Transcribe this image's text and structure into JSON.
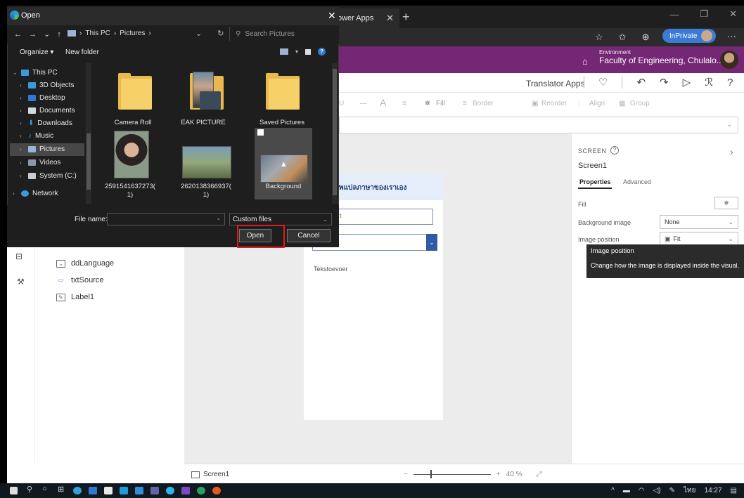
{
  "browser": {
    "tab_label": "ower Apps",
    "inprivate_label": "InPrivate"
  },
  "powerapps": {
    "environment_label": "Environment",
    "environment_name": "Faculty of Engineering, Chulalo...",
    "app_title": "Translator Apps",
    "ribbon": {
      "fill": "Fill",
      "border": "Border",
      "reorder": "Reorder",
      "align": "Align",
      "group": "Group"
    },
    "tree": {
      "items": [
        "ddLanguage",
        "txtSource",
        "Label1"
      ]
    },
    "canvas": {
      "header_text": "ัพแปลภาษาของเราเอง",
      "input_text": "t",
      "output_label": "Tekstoevoer"
    },
    "status": {
      "screen_tab": "Screen1",
      "zoom_minus": "−",
      "zoom_plus": "+",
      "zoom_value": "40 %",
      "zoom_fraction": 0.4
    },
    "properties": {
      "type_label": "SCREEN",
      "name": "Screen1",
      "tabs": [
        "Properties",
        "Advanced"
      ],
      "fill_label": "Fill",
      "bg_image_label": "Background image",
      "bg_image_value": "None",
      "image_pos_label": "Image position",
      "image_pos_value": "Fit"
    },
    "tooltip": {
      "title": "Image position",
      "body": "Change how the image is displayed inside the visual."
    }
  },
  "dialog": {
    "title": "Open",
    "breadcrumb": [
      "This PC",
      "Pictures"
    ],
    "search_placeholder": "Search Pictures",
    "toolbar": {
      "organize": "Organize",
      "new_folder": "New folder"
    },
    "nav_pane": [
      {
        "label": "This PC",
        "expanded": true
      },
      {
        "label": "3D Objects"
      },
      {
        "label": "Desktop"
      },
      {
        "label": "Documents"
      },
      {
        "label": "Downloads"
      },
      {
        "label": "Music"
      },
      {
        "label": "Pictures",
        "selected": true
      },
      {
        "label": "Videos"
      },
      {
        "label": "System (C:)"
      },
      {
        "label": "Network"
      }
    ],
    "files": [
      {
        "label": "Camera Roll",
        "kind": "folder"
      },
      {
        "label": "EAK PICTURE",
        "kind": "folder-photo"
      },
      {
        "label": "Saved Pictures",
        "kind": "folder"
      },
      {
        "label": "2591541637273(\n1)",
        "kind": "photo"
      },
      {
        "label": "2620138366937(\n1)",
        "kind": "photo"
      },
      {
        "label": "Background",
        "kind": "photo",
        "selected": true
      }
    ],
    "file_name_label": "File name:",
    "file_name_value": "",
    "file_type": "Custom files",
    "open_label": "Open",
    "cancel_label": "Cancel"
  },
  "taskbar": {
    "lang": "ไทย",
    "time": "14:27"
  },
  "colors": {
    "powerapps_purple": "#742774",
    "highlight_red": "#e01b1b",
    "dialog_bg": "#1e1e1e",
    "folder_yellow": "#f6d16a"
  }
}
